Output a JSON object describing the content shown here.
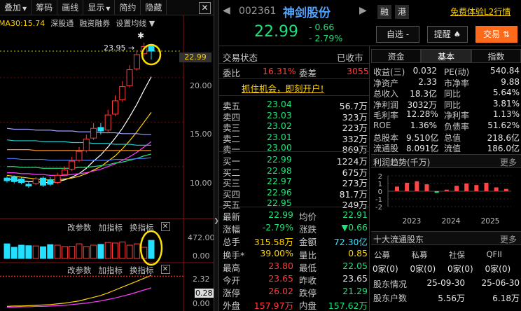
{
  "toolbar": {
    "items": [
      "叠加",
      "筹码",
      "画线",
      "显示",
      "简约",
      "隐藏"
    ],
    "close": "✕"
  },
  "ma": {
    "label": "MA30:15.74",
    "links": [
      "深股通",
      "融资融券",
      "设置均线"
    ]
  },
  "chart": {
    "high_label": "23.95",
    "last_price": "22.99",
    "y_ticks": [
      "20.00",
      "15.00",
      "10.00"
    ],
    "candles": [
      {
        "o": 8.7,
        "c": 8.4,
        "h": 8.9,
        "l": 8.2
      },
      {
        "o": 8.8,
        "c": 8.3,
        "h": 9.0,
        "l": 8.1
      },
      {
        "o": 8.6,
        "c": 8.2,
        "h": 8.8,
        "l": 8.0
      },
      {
        "o": 8.0,
        "c": 7.8,
        "h": 8.3,
        "l": 7.6
      },
      {
        "o": 8.1,
        "c": 8.6,
        "h": 8.8,
        "l": 7.9
      },
      {
        "o": 8.7,
        "c": 7.9,
        "h": 8.9,
        "l": 7.7
      },
      {
        "o": 8.5,
        "c": 8.0,
        "h": 8.8,
        "l": 7.8
      },
      {
        "o": 8.2,
        "c": 9.0,
        "h": 9.3,
        "l": 8.0
      },
      {
        "o": 9.1,
        "c": 9.6,
        "h": 10.0,
        "l": 8.9
      },
      {
        "o": 9.7,
        "c": 10.6,
        "h": 11.1,
        "l": 9.5
      },
      {
        "o": 10.7,
        "c": 11.7,
        "h": 12.2,
        "l": 10.5
      },
      {
        "o": 11.8,
        "c": 13.1,
        "h": 13.6,
        "l": 11.6
      },
      {
        "o": 13.2,
        "c": 14.3,
        "h": 14.9,
        "l": 13.0
      },
      {
        "o": 14.4,
        "c": 14.0,
        "h": 14.9,
        "l": 13.6
      },
      {
        "o": 14.1,
        "c": 15.8,
        "h": 16.4,
        "l": 13.9
      },
      {
        "o": 15.9,
        "c": 17.4,
        "h": 18.0,
        "l": 15.7
      },
      {
        "o": 17.5,
        "c": 19.0,
        "h": 19.6,
        "l": 17.3
      },
      {
        "o": 19.1,
        "c": 20.9,
        "h": 21.4,
        "l": 18.9
      },
      {
        "o": 21.0,
        "c": 22.6,
        "h": 23.1,
        "l": 20.8
      },
      {
        "o": 22.7,
        "c": 23.5,
        "h": 23.95,
        "l": 22.4
      },
      {
        "o": 23.65,
        "c": 22.99,
        "h": 23.8,
        "l": 22.05
      }
    ],
    "ma_lines": [
      {
        "color": "#ffffff",
        "values": [
          8.6,
          8.5,
          8.4,
          8.3,
          8.3,
          8.2,
          8.2,
          8.3,
          8.5,
          8.8,
          9.2,
          9.8,
          10.6,
          11.3,
          12.2,
          13.2,
          14.3,
          15.6,
          17.0,
          18.6,
          20.1
        ]
      },
      {
        "color": "#ffd400",
        "values": [
          9.0,
          8.9,
          8.8,
          8.7,
          8.6,
          8.5,
          8.5,
          8.5,
          8.6,
          8.7,
          8.9,
          9.2,
          9.6,
          10.0,
          10.6,
          11.2,
          12.0,
          12.9,
          13.9,
          15.0,
          16.1
        ]
      },
      {
        "color": "#ff3bff",
        "values": [
          9.3,
          9.3,
          9.2,
          9.2,
          9.1,
          9.1,
          9.0,
          9.0,
          9.0,
          9.1,
          9.2,
          9.3,
          9.5,
          9.7,
          10.0,
          10.3,
          10.7,
          11.1,
          11.6,
          12.2,
          12.8
        ]
      },
      {
        "color": "#22e07a",
        "values": [
          10.0,
          10.0,
          9.9,
          9.9,
          9.9,
          9.8,
          9.8,
          9.8,
          9.8,
          9.8,
          9.9,
          9.9,
          10.0,
          10.1,
          10.2,
          10.4,
          10.5,
          10.7,
          10.9,
          11.2,
          11.4
        ]
      },
      {
        "color": "#4a7bff",
        "values": [
          10.9,
          10.9,
          10.8,
          10.8,
          10.8,
          10.8,
          10.7,
          10.7,
          10.7,
          10.7,
          10.7,
          10.7,
          10.7,
          10.7,
          10.7,
          10.8,
          10.8,
          10.8,
          10.9,
          10.9,
          11.0
        ]
      },
      {
        "color": "#ff8c2a",
        "values": [
          11.9,
          11.9,
          11.9,
          11.9,
          11.8,
          11.8,
          11.8,
          11.8,
          11.8,
          11.8,
          11.8,
          11.8,
          11.8,
          11.8,
          11.8,
          11.8,
          11.8,
          11.8,
          11.8,
          11.8,
          11.8
        ]
      },
      {
        "color": "#22d0d0",
        "values": [
          13.0,
          12.9,
          12.9,
          12.9,
          12.9,
          12.8,
          12.8,
          12.8,
          12.8,
          12.7,
          12.7,
          12.7,
          12.6,
          12.6,
          12.6,
          12.5,
          12.5,
          12.5,
          12.4,
          12.4,
          12.4
        ]
      },
      {
        "color": "#a0a0ff",
        "values": [
          14.3,
          14.2,
          14.2,
          14.2,
          14.1,
          14.1,
          14.1,
          14.0,
          14.0,
          14.0,
          13.9,
          13.9,
          13.9,
          13.8,
          13.8,
          13.8,
          13.7,
          13.7,
          13.7,
          13.6,
          13.6
        ]
      }
    ],
    "vol_panel": {
      "links": [
        "改参数",
        "加指标",
        "换指标"
      ],
      "ticks": [
        "472.00",
        "0.00"
      ],
      "bars": [
        0.55,
        0.42,
        0.5,
        0.48,
        0.47,
        0.44,
        0.52,
        0.5,
        0.45,
        0.46,
        0.55,
        0.45,
        0.5,
        0.53,
        0.6,
        0.58,
        0.62,
        0.5,
        0.55,
        0.42,
        0.68
      ],
      "red": [
        false,
        false,
        false,
        false,
        true,
        false,
        false,
        true,
        true,
        true,
        true,
        true,
        true,
        false,
        true,
        true,
        true,
        true,
        true,
        true,
        false
      ]
    },
    "ind_panel": {
      "ticks": [
        "2.32",
        "0.28",
        "0.00"
      ],
      "l1": [
        0.05,
        0.06,
        0.06,
        0.07,
        0.08,
        0.09,
        0.1,
        0.12,
        0.14,
        0.17,
        0.2,
        0.25,
        0.3,
        0.35,
        0.42,
        0.5,
        0.58,
        0.66,
        0.74,
        0.82,
        0.9
      ],
      "l2": [
        0.03,
        0.03,
        0.04,
        0.04,
        0.05,
        0.05,
        0.06,
        0.07,
        0.08,
        0.1,
        0.12,
        0.14,
        0.17,
        0.2,
        0.24,
        0.28,
        0.33,
        0.38,
        0.44,
        0.5,
        0.56
      ]
    }
  },
  "quote": {
    "code": "002361",
    "name": "神剑股份",
    "prev": "◀",
    "next": "▶",
    "tag1": "融",
    "tag2": "港",
    "l2_link": "免费体验L2行情",
    "price": "22.99",
    "change": "- 0.66",
    "pct": "- 2.79%",
    "watch_btn": "自选 -",
    "alert_btn": "提醒 ♠",
    "trade_btn": "交易 ⇅"
  },
  "status": {
    "label": "交易状态",
    "value": "已收市"
  },
  "ratio": {
    "wb_label": "委比",
    "wb": "16.31%",
    "wc_label": "委差",
    "wc": "3055"
  },
  "promo": "抓住机会，即刻开户!",
  "asks": [
    {
      "l": "卖五",
      "p": "23.04",
      "v": "56.7万"
    },
    {
      "l": "卖四",
      "p": "23.03",
      "v": "323万"
    },
    {
      "l": "卖三",
      "p": "23.02",
      "v": "223万"
    },
    {
      "l": "卖二",
      "p": "23.01",
      "v": "332万"
    },
    {
      "l": "卖一",
      "p": "23.00",
      "v": "869万"
    }
  ],
  "bids": [
    {
      "l": "买一",
      "p": "22.99",
      "v": "1224万"
    },
    {
      "l": "买二",
      "p": "22.98",
      "v": "675万"
    },
    {
      "l": "买三",
      "p": "22.97",
      "v": "273万"
    },
    {
      "l": "买四",
      "p": "22.96",
      "v": "81.7万"
    },
    {
      "l": "买五",
      "p": "22.95",
      "v": "249万"
    }
  ],
  "stats": [
    [
      {
        "k": "最新",
        "v": "22.99",
        "c": "green"
      },
      {
        "k": "均价",
        "v": "22.91",
        "c": "green"
      }
    ],
    [
      {
        "k": "涨幅",
        "v": "-2.79%",
        "c": "green"
      },
      {
        "k": "涨跌",
        "v": "▼0.66",
        "c": "green"
      }
    ],
    [
      {
        "k": "总手",
        "v": "315.58万",
        "c": "yellow"
      },
      {
        "k": "金额",
        "v": "72.30亿",
        "c": "cyan"
      }
    ],
    [
      {
        "k": "换手*",
        "v": "39.00%",
        "c": "yellow"
      },
      {
        "k": "量比",
        "v": "0.85",
        "c": "yellow"
      }
    ],
    [
      {
        "k": "最高",
        "v": "23.80",
        "c": "red"
      },
      {
        "k": "最低",
        "v": "22.05",
        "c": "green"
      }
    ],
    [
      {
        "k": "今开",
        "v": "23.65",
        "c": "red"
      },
      {
        "k": "昨收",
        "v": "23.65",
        "c": "white"
      }
    ],
    [
      {
        "k": "涨停",
        "v": "26.02",
        "c": "red"
      },
      {
        "k": "跌停",
        "v": "21.29",
        "c": "green"
      }
    ],
    [
      {
        "k": "外盘",
        "v": "157.97万",
        "c": "red"
      },
      {
        "k": "内盘",
        "v": "157.62万",
        "c": "green"
      }
    ]
  ],
  "tabs": [
    "资金",
    "基本",
    "指数"
  ],
  "fund": [
    [
      {
        "k": "收益(三)",
        "v": "0.032"
      },
      {
        "k": "PE(动)",
        "v": "540.84"
      }
    ],
    [
      {
        "k": "净资产",
        "v": "2.33"
      },
      {
        "k": "市净率",
        "v": "9.88"
      }
    ],
    [
      {
        "k": "总收入",
        "v": "18.3亿"
      },
      {
        "k": "同比",
        "v": "5.64%"
      }
    ],
    [
      {
        "k": "净利润",
        "v": "3032万"
      },
      {
        "k": "同比",
        "v": "3.81%"
      }
    ],
    [
      {
        "k": "毛利率",
        "v": "12.28%"
      },
      {
        "k": "净利率",
        "v": "1.13%"
      }
    ],
    [
      {
        "k": "ROE",
        "v": "1.36%"
      },
      {
        "k": "负债率",
        "v": "51.62%"
      }
    ],
    [
      {
        "k": "总股本",
        "v": "9.510亿"
      },
      {
        "k": "总值",
        "v": "218.6亿"
      }
    ],
    [
      {
        "k": "流通股",
        "v": "8.091亿"
      },
      {
        "k": "流值",
        "v": "186.0亿"
      }
    ]
  ],
  "profit": {
    "title": "利润趋势(千万)",
    "more": "更多",
    "y_ticks": [
      "2",
      "1",
      "0",
      "-1",
      "-2"
    ],
    "years": [
      "2023",
      "2024",
      "2025"
    ],
    "values": [
      0.6,
      1.1,
      1.3,
      0.9,
      -0.2,
      0.2,
      0.7,
      1.0,
      0.8,
      1.1,
      0.5,
      0.3
    ]
  },
  "holders": {
    "title": "十大流通股东",
    "more": "更多",
    "cats": [
      "公募",
      "私募",
      "社保",
      "QFII"
    ],
    "counts": [
      "0家(0)",
      "0家(0)",
      "0家(0)",
      "0家(0)"
    ],
    "rows": [
      [
        {
          "v": "股东情况"
        },
        {
          "v": "25-09-30"
        },
        {
          "v": "25-06-30"
        }
      ],
      [
        {
          "v": "股东户数"
        },
        {
          "v": "5.56万"
        },
        {
          "v": "6.18万"
        }
      ]
    ]
  }
}
